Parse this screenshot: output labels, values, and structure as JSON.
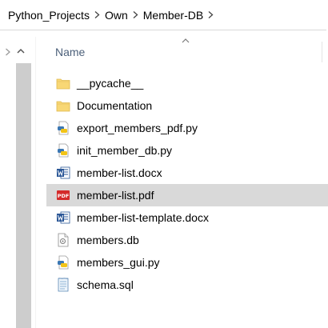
{
  "breadcrumb": {
    "items": [
      "Python_Projects",
      "Own",
      "Member-DB"
    ]
  },
  "column_header": {
    "name_label": "Name"
  },
  "files": [
    {
      "name": "__pycache__",
      "icon": "folder-icon"
    },
    {
      "name": "Documentation",
      "icon": "folder-icon"
    },
    {
      "name": "export_members_pdf.py",
      "icon": "python-file-icon"
    },
    {
      "name": "init_member_db.py",
      "icon": "python-file-icon"
    },
    {
      "name": "member-list.docx",
      "icon": "word-doc-icon"
    },
    {
      "name": "member-list.pdf",
      "icon": "pdf-file-icon",
      "selected": true
    },
    {
      "name": "member-list-template.docx",
      "icon": "word-doc-icon"
    },
    {
      "name": "members.db",
      "icon": "db-file-icon"
    },
    {
      "name": "members_gui.py",
      "icon": "python-file-icon"
    },
    {
      "name": "schema.sql",
      "icon": "sql-file-icon"
    }
  ],
  "colors": {
    "selection": "#d9d9d9",
    "folder": "#f8d775",
    "header_text": "#4c607a",
    "pdf_red": "#d42a2a",
    "word_blue": "#2b5797"
  }
}
